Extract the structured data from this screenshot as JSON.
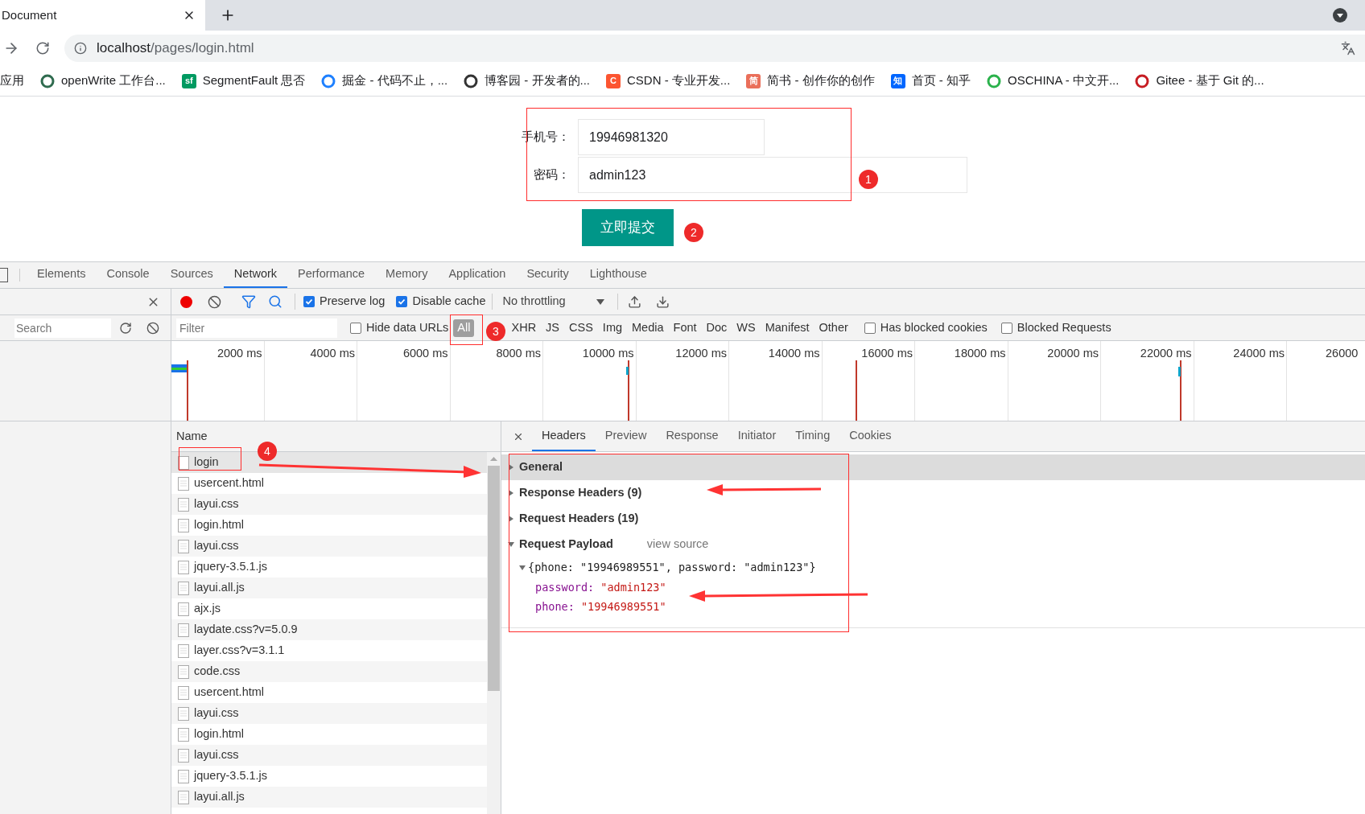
{
  "browser": {
    "tab_title": "Document",
    "url_host": "localhost",
    "url_path": "/pages/login.html",
    "bookmarks": [
      {
        "label": "应用",
        "kind": "apps"
      },
      {
        "label": "openWrite 工作台...",
        "color": "#2f6b4f",
        "kind": "logo"
      },
      {
        "label": "SegmentFault 思否",
        "color": "#009a61",
        "kind": "glyph",
        "glyph": "sf"
      },
      {
        "label": "掘金 - 代码不止，...",
        "color": "#1e80ff",
        "kind": "logo"
      },
      {
        "label": "博客园 - 开发者的...",
        "color": "#333333",
        "kind": "logo"
      },
      {
        "label": "CSDN - 专业开发...",
        "color": "#fc5531",
        "kind": "glyph",
        "glyph": "C"
      },
      {
        "label": "简书 - 创作你的创作",
        "color": "#ea6f5a",
        "kind": "glyph",
        "glyph": "简"
      },
      {
        "label": "首页 - 知乎",
        "color": "#0066ff",
        "kind": "glyph",
        "glyph": "知"
      },
      {
        "label": "OSCHINA - 中文开...",
        "color": "#2bb24c",
        "kind": "logo"
      },
      {
        "label": "Gitee - 基于 Git 的...",
        "color": "#c71d23",
        "kind": "logo"
      }
    ]
  },
  "form": {
    "fields": [
      {
        "label": "手机号：",
        "value": "19946981320",
        "wide": false
      },
      {
        "label": "密码：",
        "value": "admin123",
        "wide": true
      }
    ],
    "submit": "立即提交"
  },
  "markers": [
    "1",
    "2",
    "3",
    "4"
  ],
  "devtools": {
    "tabs": [
      {
        "label": "Elements",
        "selected": false
      },
      {
        "label": "Console",
        "selected": false
      },
      {
        "label": "Sources",
        "selected": false
      },
      {
        "label": "Network",
        "selected": true
      },
      {
        "label": "Performance",
        "selected": false
      },
      {
        "label": "Memory",
        "selected": false
      },
      {
        "label": "Application",
        "selected": false
      },
      {
        "label": "Security",
        "selected": false
      },
      {
        "label": "Lighthouse",
        "selected": false
      }
    ],
    "toolbar": {
      "recording": true,
      "preserve_log": {
        "label": "Preserve log",
        "checked": true
      },
      "disable_cache": {
        "label": "Disable cache",
        "checked": true
      },
      "throttling": "No throttling"
    },
    "sidebar_search": {
      "placeholder": "Search"
    },
    "filter": {
      "placeholder": "Filter",
      "hide_data_urls": {
        "label": "Hide data URLs",
        "checked": false
      },
      "types": [
        {
          "label": "All",
          "selected": true
        },
        {
          "label": "XHR",
          "selected": false
        },
        {
          "label": "JS",
          "selected": false
        },
        {
          "label": "CSS",
          "selected": false
        },
        {
          "label": "Img",
          "selected": false
        },
        {
          "label": "Media",
          "selected": false
        },
        {
          "label": "Font",
          "selected": false
        },
        {
          "label": "Doc",
          "selected": false
        },
        {
          "label": "WS",
          "selected": false
        },
        {
          "label": "Manifest",
          "selected": false
        },
        {
          "label": "Other",
          "selected": false
        }
      ],
      "has_blocked_cookies": {
        "label": "Has blocked cookies",
        "checked": false
      },
      "blocked_requests": {
        "label": "Blocked Requests",
        "checked": false
      }
    },
    "timeline_ticks": [
      "2000 ms",
      "4000 ms",
      "6000 ms",
      "8000 ms",
      "10000 ms",
      "12000 ms",
      "14000 ms",
      "16000 ms",
      "18000 ms",
      "20000 ms",
      "22000 ms",
      "24000 ms",
      "26000"
    ],
    "name_header": "Name",
    "requests": [
      {
        "name": "login",
        "selected": true
      },
      {
        "name": "usercent.html",
        "selected": false
      },
      {
        "name": "layui.css",
        "selected": false
      },
      {
        "name": "login.html",
        "selected": false
      },
      {
        "name": "layui.css",
        "selected": false
      },
      {
        "name": "jquery-3.5.1.js",
        "selected": false
      },
      {
        "name": "layui.all.js",
        "selected": false
      },
      {
        "name": "ajx.js",
        "selected": false
      },
      {
        "name": "laydate.css?v=5.0.9",
        "selected": false
      },
      {
        "name": "layer.css?v=3.1.1",
        "selected": false
      },
      {
        "name": "code.css",
        "selected": false
      },
      {
        "name": "usercent.html",
        "selected": false
      },
      {
        "name": "layui.css",
        "selected": false
      },
      {
        "name": "login.html",
        "selected": false
      },
      {
        "name": "layui.css",
        "selected": false
      },
      {
        "name": "jquery-3.5.1.js",
        "selected": false
      },
      {
        "name": "layui.all.js",
        "selected": false
      }
    ],
    "detail_tabs": [
      {
        "label": "Headers",
        "selected": true
      },
      {
        "label": "Preview",
        "selected": false
      },
      {
        "label": "Response",
        "selected": false
      },
      {
        "label": "Initiator",
        "selected": false
      },
      {
        "label": "Timing",
        "selected": false
      },
      {
        "label": "Cookies",
        "selected": false
      }
    ],
    "sections": [
      {
        "title": "General",
        "expanded": false,
        "highlighted": true
      },
      {
        "title": "Response Headers (9)",
        "expanded": false,
        "highlighted": false
      },
      {
        "title": "Request Headers (19)",
        "expanded": false,
        "highlighted": false
      },
      {
        "title": "Request Payload",
        "expanded": true,
        "highlighted": false,
        "link": "view source"
      }
    ],
    "payload": {
      "summary": "{phone: \"19946989551\", password: \"admin123\"}",
      "expanded": true,
      "props": [
        {
          "key": "password:",
          "value": "\"admin123\""
        },
        {
          "key": "phone:",
          "value": "\"19946989551\""
        }
      ]
    }
  }
}
